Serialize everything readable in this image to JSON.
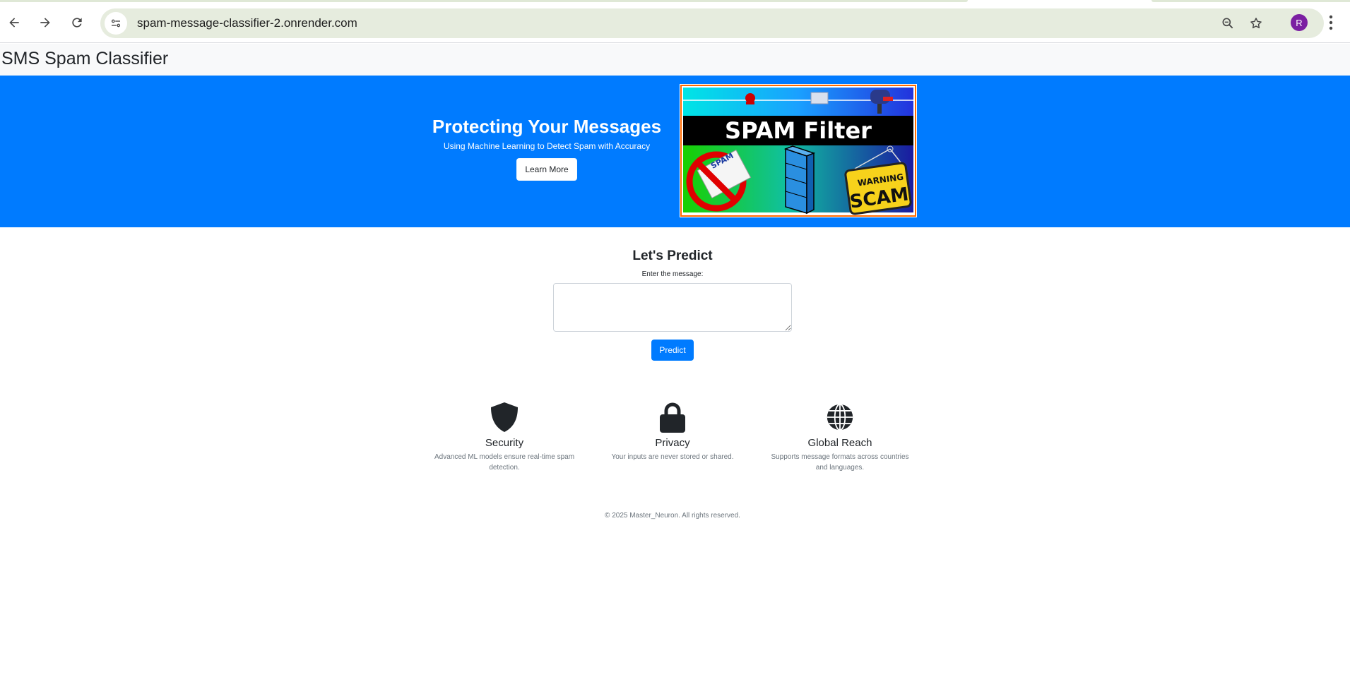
{
  "browser": {
    "url": "spam-message-classifier-2.onrender.com",
    "profile_initial": "R",
    "icons": [
      "back-arrow-icon",
      "forward-arrow-icon",
      "reload-icon",
      "site-info-icon",
      "zoom-out-icon",
      "bookmark-star-icon",
      "more-vert-icon"
    ]
  },
  "navbar": {
    "brand": "SMS Spam Classifier"
  },
  "hero": {
    "title": "Protecting Your Messages",
    "subtitle": "Using Machine Learning to Detect Spam with Accuracy",
    "button_label": "Learn More",
    "image": {
      "headline": "SPAM Filter",
      "envelope_label": "SPAM",
      "sign_top": "WARNING",
      "sign_bottom": "SCAM"
    }
  },
  "predict": {
    "title": "Let's Predict",
    "label": "Enter the message:",
    "input_value": "",
    "button_label": "Predict"
  },
  "features": [
    {
      "icon": "shield-icon",
      "title": "Security",
      "desc": "Advanced ML models ensure real-time spam detection."
    },
    {
      "icon": "lock-icon",
      "title": "Privacy",
      "desc": "Your inputs are never stored or shared."
    },
    {
      "icon": "globe-icon",
      "title": "Global Reach",
      "desc": "Supports message formats across countries and languages."
    }
  ],
  "footer": {
    "text": "© 2025 Master_Neuron. All rights reserved."
  },
  "colors": {
    "primary": "#007bff",
    "navbar_bg": "#f8f9fa",
    "omnibox_bg": "#e6ecde",
    "avatar": "#7b1fa2"
  }
}
